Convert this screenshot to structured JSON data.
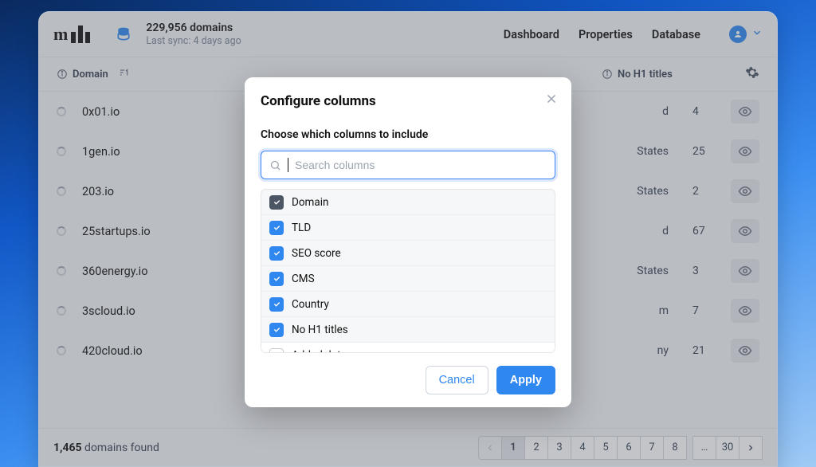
{
  "header": {
    "domain_count": "229,956 domains",
    "sync_text": "Last sync: 4 days ago",
    "nav": [
      "Dashboard",
      "Properties",
      "Database"
    ]
  },
  "table": {
    "col_domain": "Domain",
    "col_h1": "No H1 titles",
    "rows": [
      {
        "domain": "0x01.io",
        "country_fragment": "d",
        "h1": "4"
      },
      {
        "domain": "1gen.io",
        "country_fragment": "States",
        "h1": "25"
      },
      {
        "domain": "203.io",
        "country_fragment": "States",
        "h1": "2"
      },
      {
        "domain": "25startups.io",
        "country_fragment": "d",
        "h1": "67"
      },
      {
        "domain": "360energy.io",
        "country_fragment": "States",
        "h1": "3"
      },
      {
        "domain": "3scloud.io",
        "country_fragment": "m",
        "h1": "7"
      },
      {
        "domain": "420cloud.io",
        "country_fragment": "ny",
        "h1": "21"
      }
    ]
  },
  "footer": {
    "count_num": "1,465",
    "count_label": " domains found",
    "pages": [
      "1",
      "2",
      "3",
      "4",
      "5",
      "6",
      "7",
      "8"
    ],
    "ellipsis": "…",
    "last_page": "30"
  },
  "modal": {
    "title": "Configure columns",
    "subtitle": "Choose which columns to include",
    "search_placeholder": "Search columns",
    "columns": [
      {
        "label": "Domain",
        "state": "locked"
      },
      {
        "label": "TLD",
        "state": "on"
      },
      {
        "label": "SEO score",
        "state": "on"
      },
      {
        "label": "CMS",
        "state": "on"
      },
      {
        "label": "Country",
        "state": "on"
      },
      {
        "label": "No H1 titles",
        "state": "on"
      },
      {
        "label": "Added date",
        "state": "off"
      }
    ],
    "cancel": "Cancel",
    "apply": "Apply"
  }
}
